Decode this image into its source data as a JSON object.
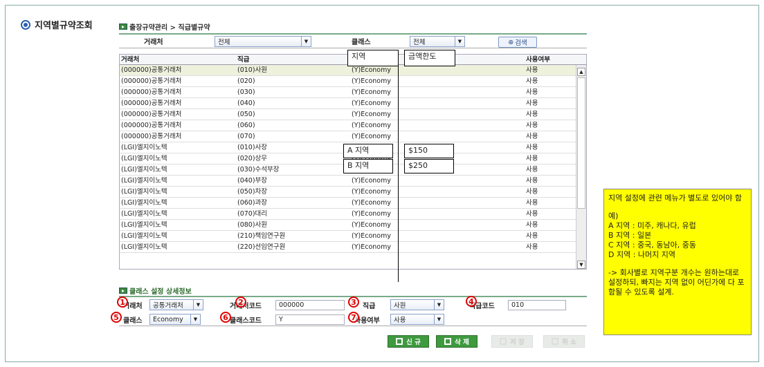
{
  "page_title": "지역별규약조회",
  "breadcrumb": "출장규약관리 > 직급별규약",
  "filter": {
    "client_label": "거래처",
    "client_value": "전체",
    "class_label": "클래스",
    "class_value": "전체",
    "search_label": "검색"
  },
  "grid": {
    "headers": [
      "거래처",
      "직급",
      "지역",
      "금액한도",
      "사용여부"
    ],
    "rows": [
      [
        "(000000)공통거래처",
        "(010)사원",
        "(Y)Economy",
        "",
        "사용"
      ],
      [
        "(000000)공통거래처",
        "(020)",
        "(Y)Economy",
        "",
        "사용"
      ],
      [
        "(000000)공통거래처",
        "(030)",
        "(Y)Economy",
        "",
        "사용"
      ],
      [
        "(000000)공통거래처",
        "(040)",
        "(Y)Economy",
        "",
        "사용"
      ],
      [
        "(000000)공통거래처",
        "(050)",
        "(Y)Economy",
        "",
        "사용"
      ],
      [
        "(000000)공통거래처",
        "(060)",
        "(Y)Economy",
        "",
        "사용"
      ],
      [
        "(000000)공통거래처",
        "(070)",
        "(Y)Economy",
        "",
        "사용"
      ],
      [
        "(LGI)엘지이노텍",
        "(010)사장",
        "(Y)Economy",
        "",
        "사용"
      ],
      [
        "(LGI)엘지이노텍",
        "(020)상무",
        "(Y)Economy",
        "",
        "사용"
      ],
      [
        "(LGI)엘지이노텍",
        "(030)수석부장",
        "(Y)Economy",
        "",
        "사용"
      ],
      [
        "(LGI)엘지이노텍",
        "(040)부장",
        "(Y)Economy",
        "",
        "사용"
      ],
      [
        "(LGI)엘지이노텍",
        "(050)차장",
        "(Y)Economy",
        "",
        "사용"
      ],
      [
        "(LGI)엘지이노텍",
        "(060)과장",
        "(Y)Economy",
        "",
        "사용"
      ],
      [
        "(LGI)엘지이노텍",
        "(070)대리",
        "(Y)Economy",
        "",
        "사용"
      ],
      [
        "(LGI)엘지이노텍",
        "(080)사원",
        "(Y)Economy",
        "",
        "사용"
      ],
      [
        "(LGI)엘지이노텍",
        "(210)책임연구원",
        "(Y)Economy",
        "",
        "사용"
      ],
      [
        "(LGI)엘지이노텍",
        "(220)선임연구원",
        "(Y)Economy",
        "",
        "사용"
      ]
    ]
  },
  "overlay": {
    "region_header": "지역",
    "limit_header": "금액한도",
    "region_a": "A 지역",
    "limit_a": "$150",
    "region_b": "B 지역",
    "limit_b": "$250"
  },
  "detail": {
    "title": "클래스 설정 상세정보",
    "client_label": "거래처",
    "client_value": "공통거래처",
    "client_code_label": "거래처코드",
    "client_code_value": "000000",
    "rank_label": "직급",
    "rank_value": "사원",
    "rank_code_label": "직급코드",
    "rank_code_value": "010",
    "class_label": "클래스",
    "class_value": "Economy",
    "class_code_label": "클래스코드",
    "class_code_value": "Y",
    "use_label": "사용여부",
    "use_value": "사용",
    "markers": [
      "1",
      "2",
      "3",
      "4",
      "5",
      "6",
      "7"
    ]
  },
  "buttons": {
    "new": "신 규",
    "delete": "삭 제",
    "save": "저 장",
    "cancel": "취 소"
  },
  "note": {
    "line1": "지역 설정에 관련 메뉴가 별도로 있어야 함",
    "line2": "예)",
    "line3": "A 지역 : 미주, 캐나다, 유럽",
    "line4": "B 지역 : 일본",
    "line5": "C 지역 : 중국, 동남아, 중동",
    "line6": "D 지역 : 나머지 지역",
    "line7": "-> 회사별로 지역구분 개수는 원하는대로 설정하되, 빠지는 지역 없이 어딘가에 다 포함될 수 있도록 설계."
  }
}
